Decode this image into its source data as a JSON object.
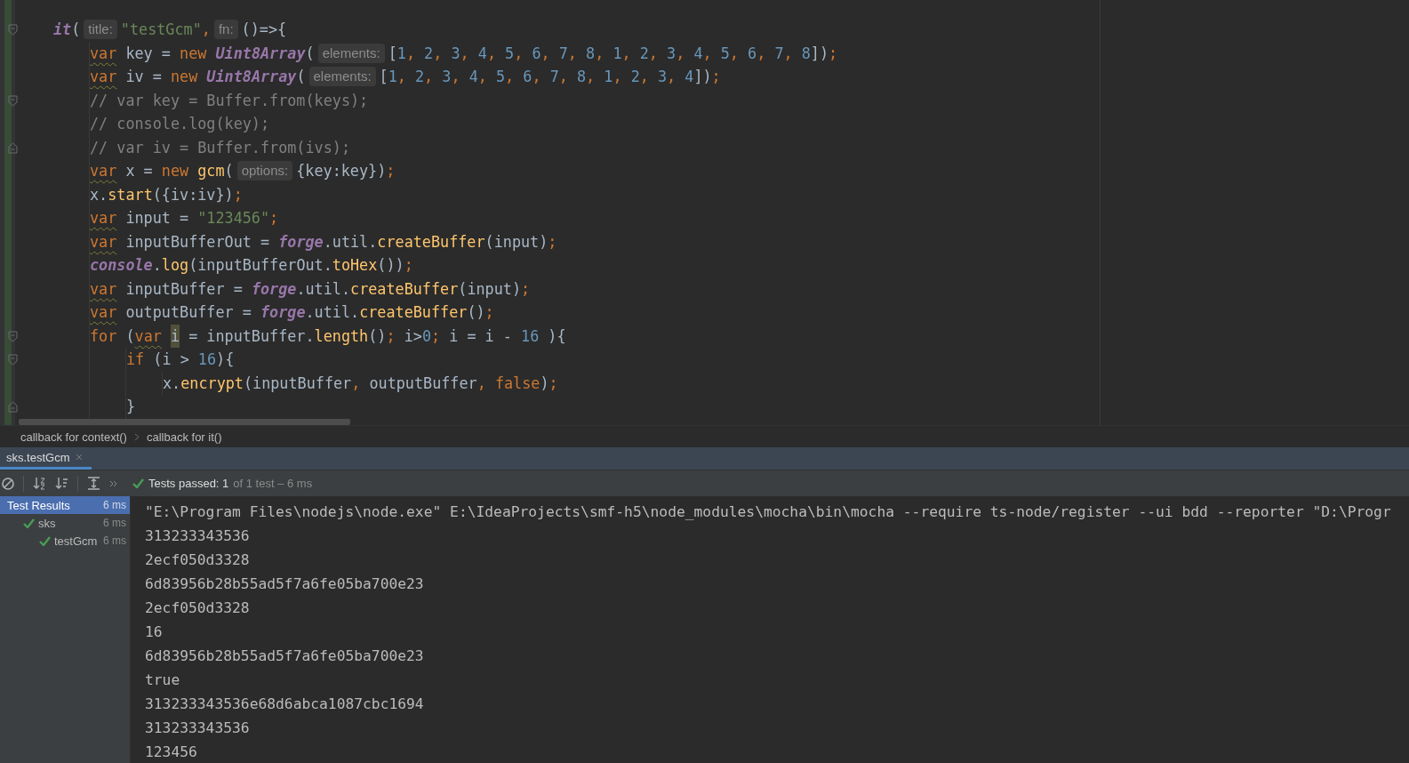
{
  "editor": {
    "lines": [
      {
        "kind": "fold-start",
        "tokens": [
          {
            "kind": "italic",
            "text": "it"
          },
          {
            "kind": "plain",
            "text": "("
          },
          {
            "kind": "hint",
            "text": "title:"
          },
          {
            "kind": "str",
            "text": "\"testGcm\""
          },
          {
            "kind": "punct",
            "text": ","
          },
          {
            "kind": "hint",
            "text": "fn:"
          },
          {
            "kind": "plain",
            "text": "()=>{"
          }
        ],
        "children": [
          {
            "kind": "code",
            "tokens": [
              {
                "kind": "decl",
                "text": "var"
              },
              {
                "kind": "plain",
                "text": " key = "
              },
              {
                "kind": "kw",
                "text": "new "
              },
              {
                "kind": "italic",
                "text": "Uint8Array"
              },
              {
                "kind": "plain",
                "text": "("
              },
              {
                "kind": "hint",
                "text": "elements:"
              },
              {
                "kind": "plain",
                "text": "["
              },
              {
                "kind": "num",
                "text": "1"
              },
              {
                "kind": "punct",
                "text": ", "
              },
              {
                "kind": "num",
                "text": "2"
              },
              {
                "kind": "punct",
                "text": ", "
              },
              {
                "kind": "num",
                "text": "3"
              },
              {
                "kind": "punct",
                "text": ", "
              },
              {
                "kind": "num",
                "text": "4"
              },
              {
                "kind": "punct",
                "text": ", "
              },
              {
                "kind": "num",
                "text": "5"
              },
              {
                "kind": "punct",
                "text": ", "
              },
              {
                "kind": "num",
                "text": "6"
              },
              {
                "kind": "punct",
                "text": ", "
              },
              {
                "kind": "num",
                "text": "7"
              },
              {
                "kind": "punct",
                "text": ", "
              },
              {
                "kind": "num",
                "text": "8"
              },
              {
                "kind": "punct",
                "text": ", "
              },
              {
                "kind": "num",
                "text": "1"
              },
              {
                "kind": "punct",
                "text": ", "
              },
              {
                "kind": "num",
                "text": "2"
              },
              {
                "kind": "punct",
                "text": ", "
              },
              {
                "kind": "num",
                "text": "3"
              },
              {
                "kind": "punct",
                "text": ", "
              },
              {
                "kind": "num",
                "text": "4"
              },
              {
                "kind": "punct",
                "text": ", "
              },
              {
                "kind": "num",
                "text": "5"
              },
              {
                "kind": "punct",
                "text": ", "
              },
              {
                "kind": "num",
                "text": "6"
              },
              {
                "kind": "punct",
                "text": ", "
              },
              {
                "kind": "num",
                "text": "7"
              },
              {
                "kind": "punct",
                "text": ", "
              },
              {
                "kind": "num",
                "text": "8"
              },
              {
                "kind": "plain",
                "text": "])"
              },
              {
                "kind": "punct",
                "text": ";"
              }
            ]
          },
          {
            "kind": "code",
            "tokens": [
              {
                "kind": "decl",
                "text": "var"
              },
              {
                "kind": "plain",
                "text": " iv = "
              },
              {
                "kind": "kw",
                "text": "new "
              },
              {
                "kind": "italic",
                "text": "Uint8Array"
              },
              {
                "kind": "plain",
                "text": "("
              },
              {
                "kind": "hint",
                "text": "elements:"
              },
              {
                "kind": "plain",
                "text": "["
              },
              {
                "kind": "num",
                "text": "1"
              },
              {
                "kind": "punct",
                "text": ", "
              },
              {
                "kind": "num",
                "text": "2"
              },
              {
                "kind": "punct",
                "text": ", "
              },
              {
                "kind": "num",
                "text": "3"
              },
              {
                "kind": "punct",
                "text": ", "
              },
              {
                "kind": "num",
                "text": "4"
              },
              {
                "kind": "punct",
                "text": ", "
              },
              {
                "kind": "num",
                "text": "5"
              },
              {
                "kind": "punct",
                "text": ", "
              },
              {
                "kind": "num",
                "text": "6"
              },
              {
                "kind": "punct",
                "text": ", "
              },
              {
                "kind": "num",
                "text": "7"
              },
              {
                "kind": "punct",
                "text": ", "
              },
              {
                "kind": "num",
                "text": "8"
              },
              {
                "kind": "punct",
                "text": ", "
              },
              {
                "kind": "num",
                "text": "1"
              },
              {
                "kind": "punct",
                "text": ", "
              },
              {
                "kind": "num",
                "text": "2"
              },
              {
                "kind": "punct",
                "text": ", "
              },
              {
                "kind": "num",
                "text": "3"
              },
              {
                "kind": "punct",
                "text": ", "
              },
              {
                "kind": "num",
                "text": "4"
              },
              {
                "kind": "plain",
                "text": "])"
              },
              {
                "kind": "punct",
                "text": ";"
              }
            ]
          },
          {
            "kind": "fold-start",
            "tokens": [
              {
                "kind": "comment",
                "text": "// var key = Buffer.from(keys);"
              }
            ]
          },
          {
            "kind": "code",
            "tokens": [
              {
                "kind": "comment",
                "text": "// console.log(key);"
              }
            ]
          },
          {
            "kind": "fold-end",
            "tokens": [
              {
                "kind": "comment",
                "text": "// var iv = Buffer.from(ivs);"
              }
            ]
          },
          {
            "kind": "code",
            "tokens": [
              {
                "kind": "decl",
                "text": "var"
              },
              {
                "kind": "plain",
                "text": " x = "
              },
              {
                "kind": "kw",
                "text": "new "
              },
              {
                "kind": "fn",
                "text": "gcm"
              },
              {
                "kind": "plain",
                "text": "("
              },
              {
                "kind": "hint",
                "text": "options:"
              },
              {
                "kind": "plain",
                "text": "{key:key})"
              },
              {
                "kind": "punct",
                "text": ";"
              }
            ]
          },
          {
            "kind": "code",
            "tokens": [
              {
                "kind": "plain",
                "text": "x."
              },
              {
                "kind": "fn",
                "text": "start"
              },
              {
                "kind": "plain",
                "text": "({iv:iv})"
              },
              {
                "kind": "punct",
                "text": ";"
              }
            ]
          },
          {
            "kind": "code",
            "tokens": [
              {
                "kind": "decl",
                "text": "var"
              },
              {
                "kind": "plain",
                "text": " input = "
              },
              {
                "kind": "str",
                "text": "\"123456\""
              },
              {
                "kind": "punct",
                "text": ";"
              }
            ]
          },
          {
            "kind": "code",
            "tokens": [
              {
                "kind": "decl",
                "text": "var"
              },
              {
                "kind": "plain",
                "text": " inputBufferOut = "
              },
              {
                "kind": "italic",
                "text": "forge"
              },
              {
                "kind": "plain",
                "text": ".util."
              },
              {
                "kind": "fn",
                "text": "createBuffer"
              },
              {
                "kind": "plain",
                "text": "(input)"
              },
              {
                "kind": "punct",
                "text": ";"
              }
            ]
          },
          {
            "kind": "code",
            "tokens": [
              {
                "kind": "italic",
                "text": "console"
              },
              {
                "kind": "plain",
                "text": "."
              },
              {
                "kind": "fn",
                "text": "log"
              },
              {
                "kind": "plain",
                "text": "(inputBufferOut."
              },
              {
                "kind": "fn",
                "text": "toHex"
              },
              {
                "kind": "plain",
                "text": "())"
              },
              {
                "kind": "punct",
                "text": ";"
              }
            ]
          },
          {
            "kind": "code",
            "tokens": [
              {
                "kind": "decl",
                "text": "var"
              },
              {
                "kind": "plain",
                "text": " inputBuffer = "
              },
              {
                "kind": "italic",
                "text": "forge"
              },
              {
                "kind": "plain",
                "text": ".util."
              },
              {
                "kind": "fn",
                "text": "createBuffer"
              },
              {
                "kind": "plain",
                "text": "(input)"
              },
              {
                "kind": "punct",
                "text": ";"
              }
            ]
          },
          {
            "kind": "code",
            "tokens": [
              {
                "kind": "decl",
                "text": "var"
              },
              {
                "kind": "plain",
                "text": " outputBuffer = "
              },
              {
                "kind": "italic",
                "text": "forge"
              },
              {
                "kind": "plain",
                "text": ".util."
              },
              {
                "kind": "fn",
                "text": "createBuffer"
              },
              {
                "kind": "plain",
                "text": "()"
              },
              {
                "kind": "punct",
                "text": ";"
              }
            ]
          },
          {
            "kind": "fold-start",
            "tokens": [
              {
                "kind": "kw",
                "text": "for"
              },
              {
                "kind": "plain",
                "text": " ("
              },
              {
                "kind": "decl",
                "text": "var"
              },
              {
                "kind": "caret",
                "text": "i"
              },
              {
                "kind": "plain",
                "text": " = inputBuffer."
              },
              {
                "kind": "fn",
                "text": "length"
              },
              {
                "kind": "plain",
                "text": "()"
              },
              {
                "kind": "punct",
                "text": "; "
              },
              {
                "kind": "plain",
                "text": "i>"
              },
              {
                "kind": "num",
                "text": "0"
              },
              {
                "kind": "punct",
                "text": "; "
              },
              {
                "kind": "plain",
                "text": "i = i - "
              },
              {
                "kind": "num",
                "text": "16"
              },
              {
                "kind": "plain",
                "text": " ){"
              }
            ],
            "children": [
              {
                "kind": "fold-start",
                "tokens": [
                  {
                    "kind": "kw",
                    "text": "if"
                  },
                  {
                    "kind": "plain",
                    "text": " (i > "
                  },
                  {
                    "kind": "num",
                    "text": "16"
                  },
                  {
                    "kind": "plain",
                    "text": "){"
                  }
                ],
                "children": [
                  {
                    "kind": "code",
                    "tokens": [
                      {
                        "kind": "plain",
                        "text": "x."
                      },
                      {
                        "kind": "fn",
                        "text": "encrypt"
                      },
                      {
                        "kind": "plain",
                        "text": "(inputBuffer"
                      },
                      {
                        "kind": "punct",
                        "text": ", "
                      },
                      {
                        "kind": "plain",
                        "text": "outputBuffer"
                      },
                      {
                        "kind": "punct",
                        "text": ", "
                      },
                      {
                        "kind": "kw",
                        "text": "false"
                      },
                      {
                        "kind": "plain",
                        "text": ")"
                      },
                      {
                        "kind": "punct",
                        "text": ";"
                      }
                    ]
                  }
                ]
              },
              {
                "kind": "fold-end",
                "tokens": [
                  {
                    "kind": "plain",
                    "text": "}"
                  }
                ]
              }
            ]
          }
        ]
      }
    ]
  },
  "breadcrumbs": [
    "callback for context()",
    "callback for it()"
  ],
  "run_tabs": [
    {
      "label": "sks.testGcm",
      "selected": true
    }
  ],
  "run_status": {
    "passed": "Tests passed: 1",
    "detail": "of 1 test – 6 ms"
  },
  "test_tree": [
    {
      "label": "Test Results",
      "time": "6 ms",
      "passed": false,
      "selected": true,
      "children": [
        {
          "label": "sks",
          "time": "6 ms",
          "passed": true,
          "selected": false,
          "children": [
            {
              "label": "testGcm",
              "time": "6 ms",
              "passed": true,
              "selected": false
            }
          ]
        }
      ]
    }
  ],
  "console": [
    "\"E:\\Program Files\\nodejs\\node.exe\" E:\\IdeaProjects\\smf-h5\\node_modules\\mocha\\bin\\mocha --require ts-node/register --ui bdd --reporter \"D:\\Progr",
    "313233343536",
    "2ecf050d3328",
    "6d83956b28b55ad5f7a6fe05ba700e23",
    "2ecf050d3328",
    "16",
    "6d83956b28b55ad5f7a6fe05ba700e23",
    "true",
    "313233343536e68d6abca1087cbc1694",
    "313233343536",
    "123456"
  ]
}
